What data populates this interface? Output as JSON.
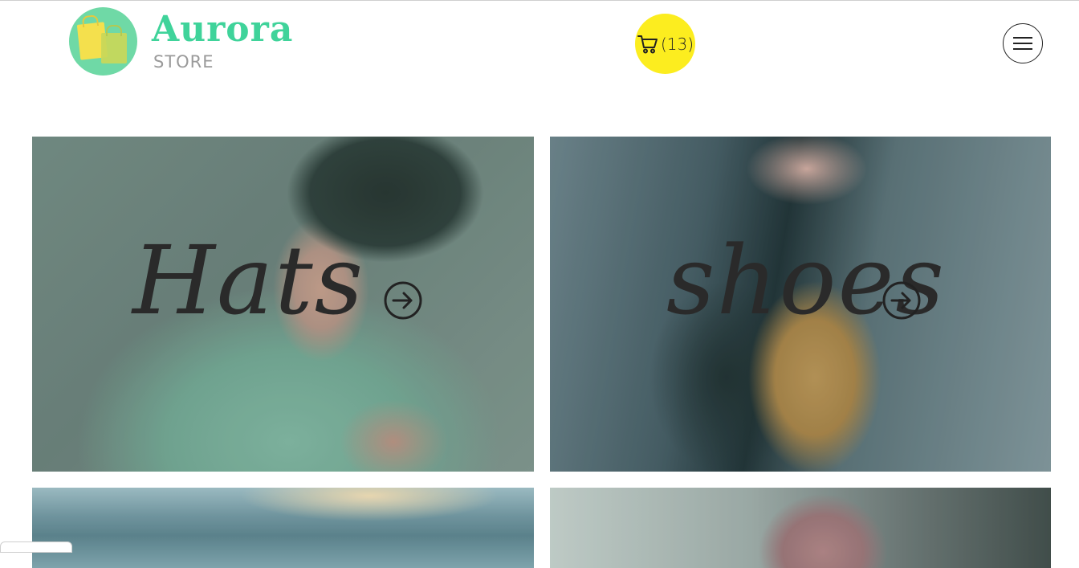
{
  "header": {
    "logo": {
      "title": "Aurora",
      "subtitle": "STORE",
      "icon": "shopping-bags-icon",
      "colors": {
        "circle": "#6fd9a6",
        "title": "#3fd39a",
        "subtitle": "#9a9a9a"
      }
    },
    "cart": {
      "count_label": "(13)",
      "icon": "shopping-cart-icon",
      "background": "#fced1f"
    },
    "menu": {
      "icon": "hamburger-menu-icon"
    }
  },
  "categories": [
    {
      "label": "Hats",
      "icon": "arrow-right-circle-icon",
      "image": "person-in-cap"
    },
    {
      "label": "shoes",
      "icon": "arrow-right-circle-icon",
      "image": "boots-lacing"
    },
    {
      "label": "",
      "image": "sky-landscape"
    },
    {
      "label": "",
      "image": "suit-jacket"
    }
  ]
}
